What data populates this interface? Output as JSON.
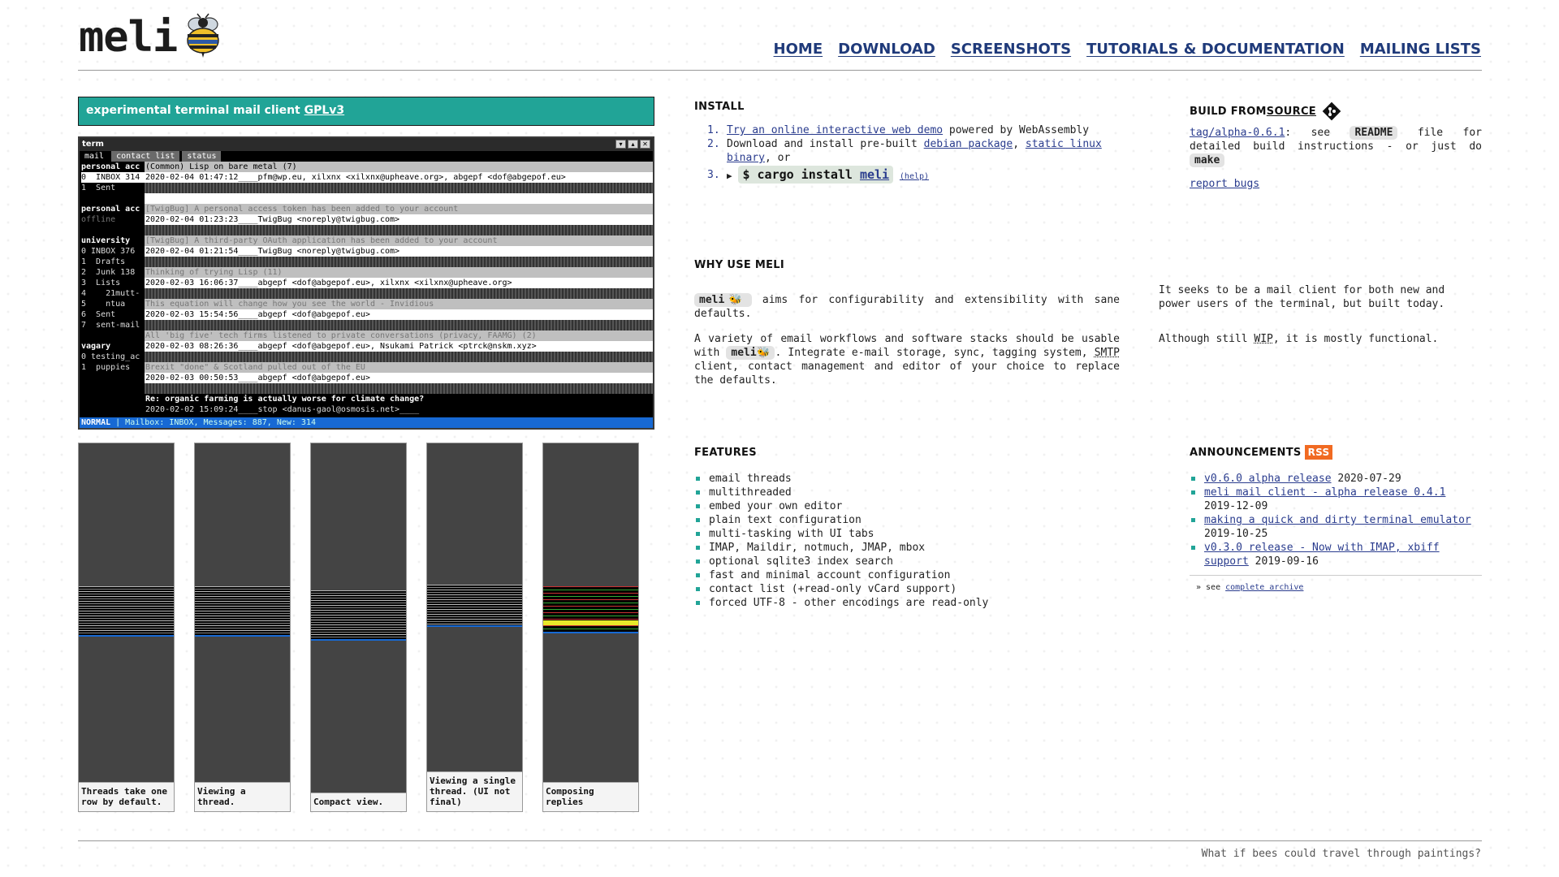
{
  "logo": {
    "text": "meli"
  },
  "nav": [
    "HOME",
    "DOWNLOAD",
    "SCREENSHOTS",
    "TUTORIALS & DOCUMENTATION",
    "MAILING LISTS"
  ],
  "tagline": {
    "text": "experimental terminal mail client ",
    "license": "GPLv3"
  },
  "terminal": {
    "title": "term",
    "tabs": [
      "mail",
      "contact list",
      "status"
    ],
    "sidebar": [
      {
        "text": "personal acc",
        "kind": "acc"
      },
      {
        "text": "0  INBOX 314",
        "kind": "sel"
      },
      {
        "text": "1  Sent",
        "kind": ""
      },
      {
        "text": "",
        "kind": ""
      },
      {
        "text": "personal acc",
        "kind": "acc"
      },
      {
        "text": "offline",
        "kind": "off"
      },
      {
        "text": "",
        "kind": ""
      },
      {
        "text": "university",
        "kind": "acc"
      },
      {
        "text": "0 INBOX 376",
        "kind": ""
      },
      {
        "text": "1  Drafts",
        "kind": ""
      },
      {
        "text": "2  Junk 138",
        "kind": ""
      },
      {
        "text": "3  Lists",
        "kind": ""
      },
      {
        "text": "4    21mutt-",
        "kind": ""
      },
      {
        "text": "5    ntua",
        "kind": ""
      },
      {
        "text": "6  Sent",
        "kind": ""
      },
      {
        "text": "7  sent-mail",
        "kind": ""
      },
      {
        "text": "",
        "kind": ""
      },
      {
        "text": "vagary",
        "kind": "acc"
      },
      {
        "text": "0 testing_ac",
        "kind": ""
      },
      {
        "text": "1  puppies",
        "kind": ""
      }
    ],
    "threads": [
      {
        "subject": "(Common) Lisp on bare metal (7)",
        "info": "2020-02-04 01:47:12____pfm@wp.eu, xilxnx <xilxnx@upheave.org>, abgepf <dof@abgepof.eu>",
        "dim": false
      },
      {
        "subject": "[TwigBug] A personal access token has been added to your account",
        "info": "2020-02-04 01:23:23____TwigBug <noreply@twigbug.com>",
        "dim": true
      },
      {
        "subject": "[TwigBug] A third-party OAuth application has been added to your account",
        "info": "2020-02-04 01:21:54____TwigBug <noreply@twigbug.com>",
        "dim": true
      },
      {
        "subject": "Thinking of trying Lisp (11)",
        "info": "2020-02-03 16:06:37____abgepf <dof@abgepof.eu>, xilxnx <xilxnx@upheave.org>",
        "dim": true
      },
      {
        "subject": "This equation will change how you see the world - Invidious",
        "info": "2020-02-03 15:54:56____abgepf <dof@abgepof.eu>",
        "dim": true
      },
      {
        "subject": "All 'big five' tech firms listened to private conversations (privacy, FAAMG) (2)",
        "info": "2020-02-03 08:26:36____abgepf <dof@abgepof.eu>, Nsukami Patrick <ptrck@nskm.xyz>",
        "dim": true
      },
      {
        "subject": "Brexit \"done\" & Scotland pulled out of the EU",
        "info": "2020-02-03 00:50:53____abgepf <dof@abgepof.eu>",
        "dim": true
      }
    ],
    "current": {
      "subject": "Re: organic farming is actually worse for climate change?",
      "info": "2020-02-02 15:09:24____stop <danus-gaol@osmosis.net>____"
    },
    "status": {
      "mode": "NORMAL",
      "text": " | Mailbox: INBOX, Messages: 887, New: 314"
    }
  },
  "thumbs": [
    {
      "caption": "Threads take one row by default."
    },
    {
      "caption": "Viewing a thread."
    },
    {
      "caption": "Compact view."
    },
    {
      "caption": "Viewing a single thread. (UI not final)"
    },
    {
      "caption": "Composing replies"
    }
  ],
  "install": {
    "heading": "INSTALL",
    "item1_link": "Try an online interactive web demo",
    "item1_rest": " powered by WebAssembly",
    "item2_pre": "Download and install pre-built ",
    "item2_link1": "debian package",
    "item2_sep": ", ",
    "item2_link2": "static linux binary",
    "item2_post": ", or",
    "item3_arrow": "▶",
    "item3_cmd": "$ cargo install ",
    "item3_pkg": "meli",
    "item3_help": "(help)"
  },
  "build": {
    "heading": "BUILD FROM ",
    "heading_link": "SOURCE",
    "tag_link": "tag/alpha-0.6.1",
    "text1": ":  see ",
    "readme": "README",
    "text2": " file for detailed build instructions - or just do ",
    "make": "make",
    "report": "report bugs"
  },
  "why": {
    "heading": "WHY USE MELI",
    "meli_badge": "meli",
    "p1_rest": " aims for configurability and extensibility with sane defaults.",
    "p2_pre": "A variety of email workflows and software stacks should be usable with ",
    "p2_rest": ". Integrate e-mail storage, sync, tagging system, ",
    "smtp": "SMTP",
    "p2_end": " client, contact management and editor of your choice to replace the defaults.",
    "right1": "It seeks to be a mail client for both new and power users of the terminal, but built today.",
    "right2_pre": "Although still ",
    "wip": "WIP",
    "right2_post": ", it is mostly functional."
  },
  "features": {
    "heading": "FEATURES",
    "items": [
      "email threads",
      "multithreaded",
      "embed your own editor",
      "plain text configuration",
      "multi-tasking with UI tabs",
      "IMAP, Maildir, notmuch, JMAP, mbox",
      "optional sqlite3 index search",
      "fast and minimal account configuration",
      "contact list (+read-only vCard support)",
      "forced UTF-8 - other encodings are read-only"
    ]
  },
  "announcements": {
    "heading": "ANNOUNCEMENTS",
    "rss": "RSS",
    "items": [
      {
        "title": "v0.6.0 alpha release",
        "date": "2020-07-29"
      },
      {
        "title": "meli mail client - alpha release 0.4.1",
        "date": "2019-12-09"
      },
      {
        "title": "making a quick and dirty terminal emulator",
        "date": "2019-10-25"
      },
      {
        "title": "v0.3.0 release - Now with IMAP, xbiff support",
        "date": "2019-09-16"
      }
    ],
    "see": "» see ",
    "archive": "complete archive"
  },
  "footer": {
    "quote": "What if bees could travel through paintings?"
  },
  "colors": {
    "accent": "#21a497",
    "link": "#2a3c8e",
    "rss": "#f16a22",
    "status": "#1769d4"
  }
}
